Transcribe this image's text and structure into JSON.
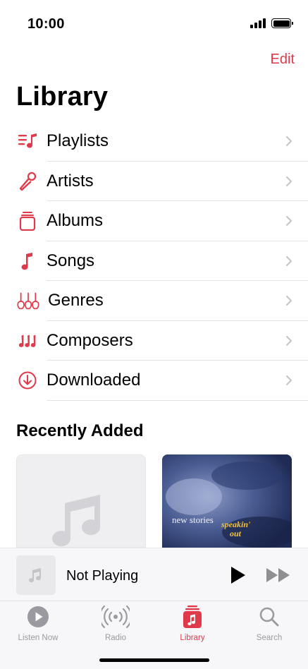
{
  "status": {
    "time": "10:00"
  },
  "header": {
    "edit_label": "Edit",
    "title": "Library"
  },
  "library_items": [
    {
      "label": "Playlists",
      "icon": "playlist-icon"
    },
    {
      "label": "Artists",
      "icon": "microphone-icon"
    },
    {
      "label": "Albums",
      "icon": "album-stack-icon"
    },
    {
      "label": "Songs",
      "icon": "music-note-icon"
    },
    {
      "label": "Genres",
      "icon": "guitars-icon"
    },
    {
      "label": "Composers",
      "icon": "music-notes-icon"
    },
    {
      "label": "Downloaded",
      "icon": "download-circle-icon"
    }
  ],
  "recent": {
    "title": "Recently Added",
    "album2_art_text": [
      "new stories",
      "speakin'",
      "out"
    ]
  },
  "mini_player": {
    "title": "Not Playing"
  },
  "tabs": [
    {
      "label": "Listen Now",
      "icon": "play-circle-icon",
      "active": false
    },
    {
      "label": "Radio",
      "icon": "radio-waves-icon",
      "active": false
    },
    {
      "label": "Library",
      "icon": "library-icon",
      "active": true
    },
    {
      "label": "Search",
      "icon": "search-icon",
      "active": false
    }
  ],
  "colors": {
    "accent": "#e0394a",
    "inactive": "#9a9aa0"
  }
}
